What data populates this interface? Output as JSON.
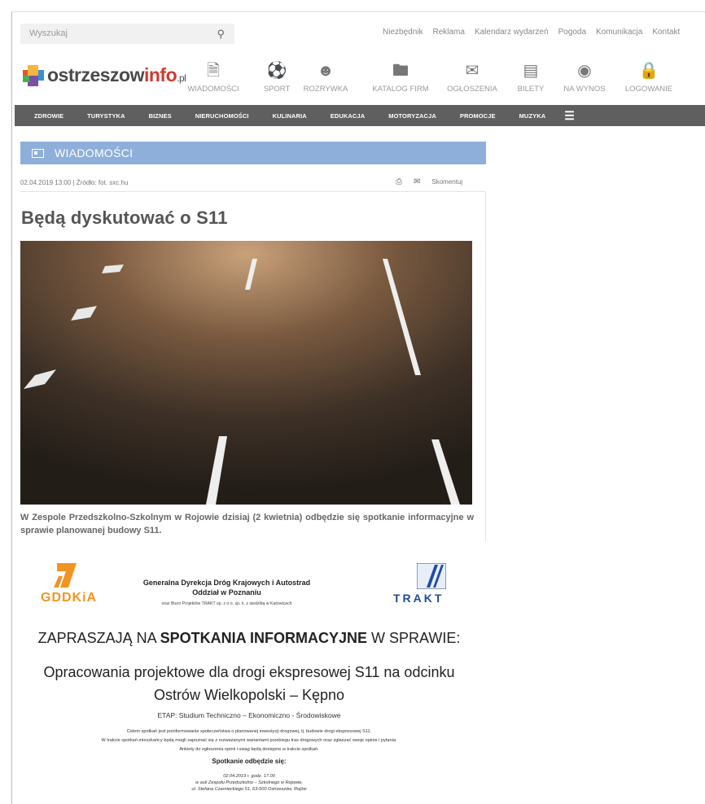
{
  "search": {
    "placeholder": "Wyszukaj"
  },
  "toplinks": [
    "Niezbędnik",
    "Reklama",
    "Kalendarz wydarzeń",
    "Pogoda",
    "Komunikacja",
    "Kontakt"
  ],
  "logo": {
    "main": "ostrzeszow",
    "accent": "info",
    "suffix": ".pl"
  },
  "icon_nav": [
    {
      "label": "WIADOMOŚCI",
      "icon": "document-icon"
    },
    {
      "label": "SPORT",
      "icon": "ball-icon"
    },
    {
      "label": "ROZRYWKA",
      "icon": "masks-icon"
    },
    {
      "label": "KATALOG FIRM",
      "icon": "folder-icon"
    },
    {
      "label": "OGŁOSZENIA",
      "icon": "chat-icon"
    },
    {
      "label": "BILETY",
      "icon": "tickets-icon"
    },
    {
      "label": "NA WYNOS",
      "icon": "plate-icon"
    },
    {
      "label": "LOGOWANIE",
      "icon": "lock-icon"
    }
  ],
  "nav": [
    "ZDROWIE",
    "TURYSTYKA",
    "BIZNES",
    "NIERUCHOMOŚCI",
    "KULINARIA",
    "EDUKACJA",
    "MOTORYZACJA",
    "PROMOCJE",
    "MUZYKA"
  ],
  "section": {
    "title": "WIADOMOŚCI"
  },
  "article": {
    "meta": "02.04.2019 13:00 | Źródło: fot. sxc.hu",
    "comment_label": "Skomentuj",
    "title": "Będą dyskutować o S11",
    "lead": "W Zespole Przedszkolno-Szkolnym w Rojowie dzisiaj (2 kwietnia) odbędzie się spotkanie informacyjne w sprawie planowanej budowy S11."
  },
  "poster": {
    "gddkia": "GDDKiA",
    "org_line1": "Generalna Dyrekcja Dróg Krajowych i Autostrad",
    "org_line2": "Oddział w Poznaniu",
    "org_line3": "oraz Biuro Projektów TRAKT sp. z o.o. sp. k. z siedzibą w Katowicach",
    "trakt": "TRAKT",
    "invite_pre": "ZAPRASZAJĄ NA ",
    "invite_bold": "SPOTKANIA INFORMACYJNE",
    "invite_post": " W SPRAWIE:",
    "project_line1": "Opracowania projektowe dla drogi ekspresowej S11 na odcinku",
    "project_line2": "Ostrów Wielkopolski – Kępno",
    "stage": "ETAP: Studium Techniczno – Ekonomiczno - Środowiskowe",
    "body1": "Celem spotkań jest poinformowanie społeczeństwa o planowanej inwestycji drogowej, tj. budowie drogi ekspresowej S11.",
    "body2": "W trakcie spotkań mieszkańcy będą mogli zapoznać się z rozważanymi wariantami przebiegu tras drogowych oraz zgłaszać swoje opinie i pytania.",
    "body3": "Ankiety do zgłoszenia opinii i uwag będą dostępne w trakcie spotkań.",
    "when_title": "Spotkanie odbędzie się:",
    "when1": "02.04.2019 r.  godz. 17.00",
    "when2": "w auli Zespołu Przedszkolno – Szkolnego w Rojowie,",
    "when3": "ul. Stefana Czarnieckiego 51, 63-500 Ostrzeszów, Rojów"
  },
  "colors": {
    "nav_bg": "#5f5f5f",
    "section_bg": "#8eafd9",
    "logo_accent": "#d2382f",
    "gddkia_orange": "#f29423",
    "trakt_blue": "#1f4c9c"
  }
}
